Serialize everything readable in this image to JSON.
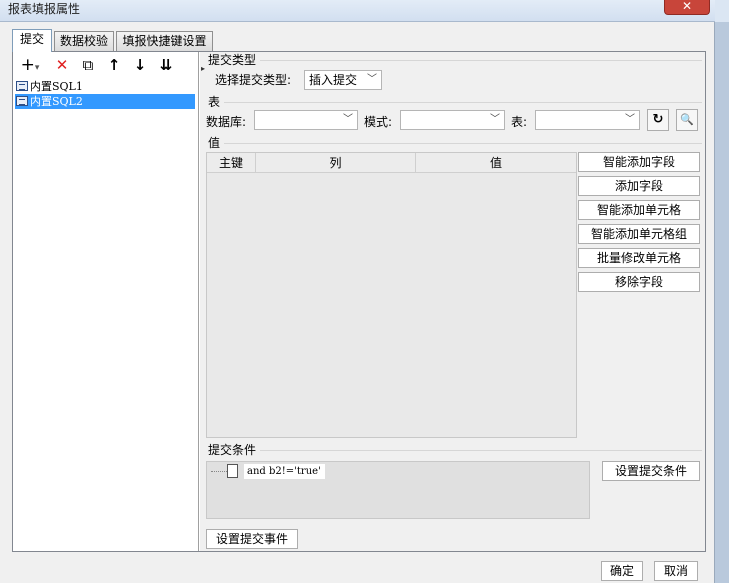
{
  "window": {
    "title": "报表填报属性",
    "close_symbol": "✕"
  },
  "tabs": [
    {
      "label": "提交",
      "active": true
    },
    {
      "label": "数据校验",
      "active": false
    },
    {
      "label": "填报快捷键设置",
      "active": false
    }
  ],
  "toolbar": {
    "add": "+",
    "dropdown": "▾",
    "delete": "✕",
    "copy": "⧉",
    "up": "↑",
    "down": "↓",
    "move_bottom": "⇊"
  },
  "tree": [
    {
      "label": "内置SQL1",
      "selected": false
    },
    {
      "label": "内置SQL2",
      "selected": true
    }
  ],
  "splitter_arrow": "▸",
  "submit_type": {
    "section": "提交类型",
    "label": "选择提交类型:",
    "value": "插入提交",
    "arrow": "﹀"
  },
  "table_section": {
    "section": "表",
    "database_label": "数据库:",
    "database_value": "",
    "schema_label": "模式:",
    "schema_value": "",
    "table_label": "表:",
    "table_value": "",
    "arrow": "﹀",
    "refresh_icon": "↻",
    "preview_icon": "🔍"
  },
  "values_section": {
    "section": "值",
    "columns": [
      "主键",
      "列",
      "值"
    ],
    "rows": []
  },
  "side_buttons": [
    "智能添加字段",
    "添加字段",
    "智能添加单元格",
    "智能添加单元格组",
    "批量修改单元格",
    "移除字段"
  ],
  "condition": {
    "section": "提交条件",
    "item": "and b2!='true'",
    "button": "设置提交条件"
  },
  "event_button": "设置提交事件",
  "footer": {
    "ok": "确定",
    "cancel": "取消"
  },
  "colors": {
    "selection": "#3399ff",
    "close": "#c8453a",
    "delete": "#e02020"
  }
}
